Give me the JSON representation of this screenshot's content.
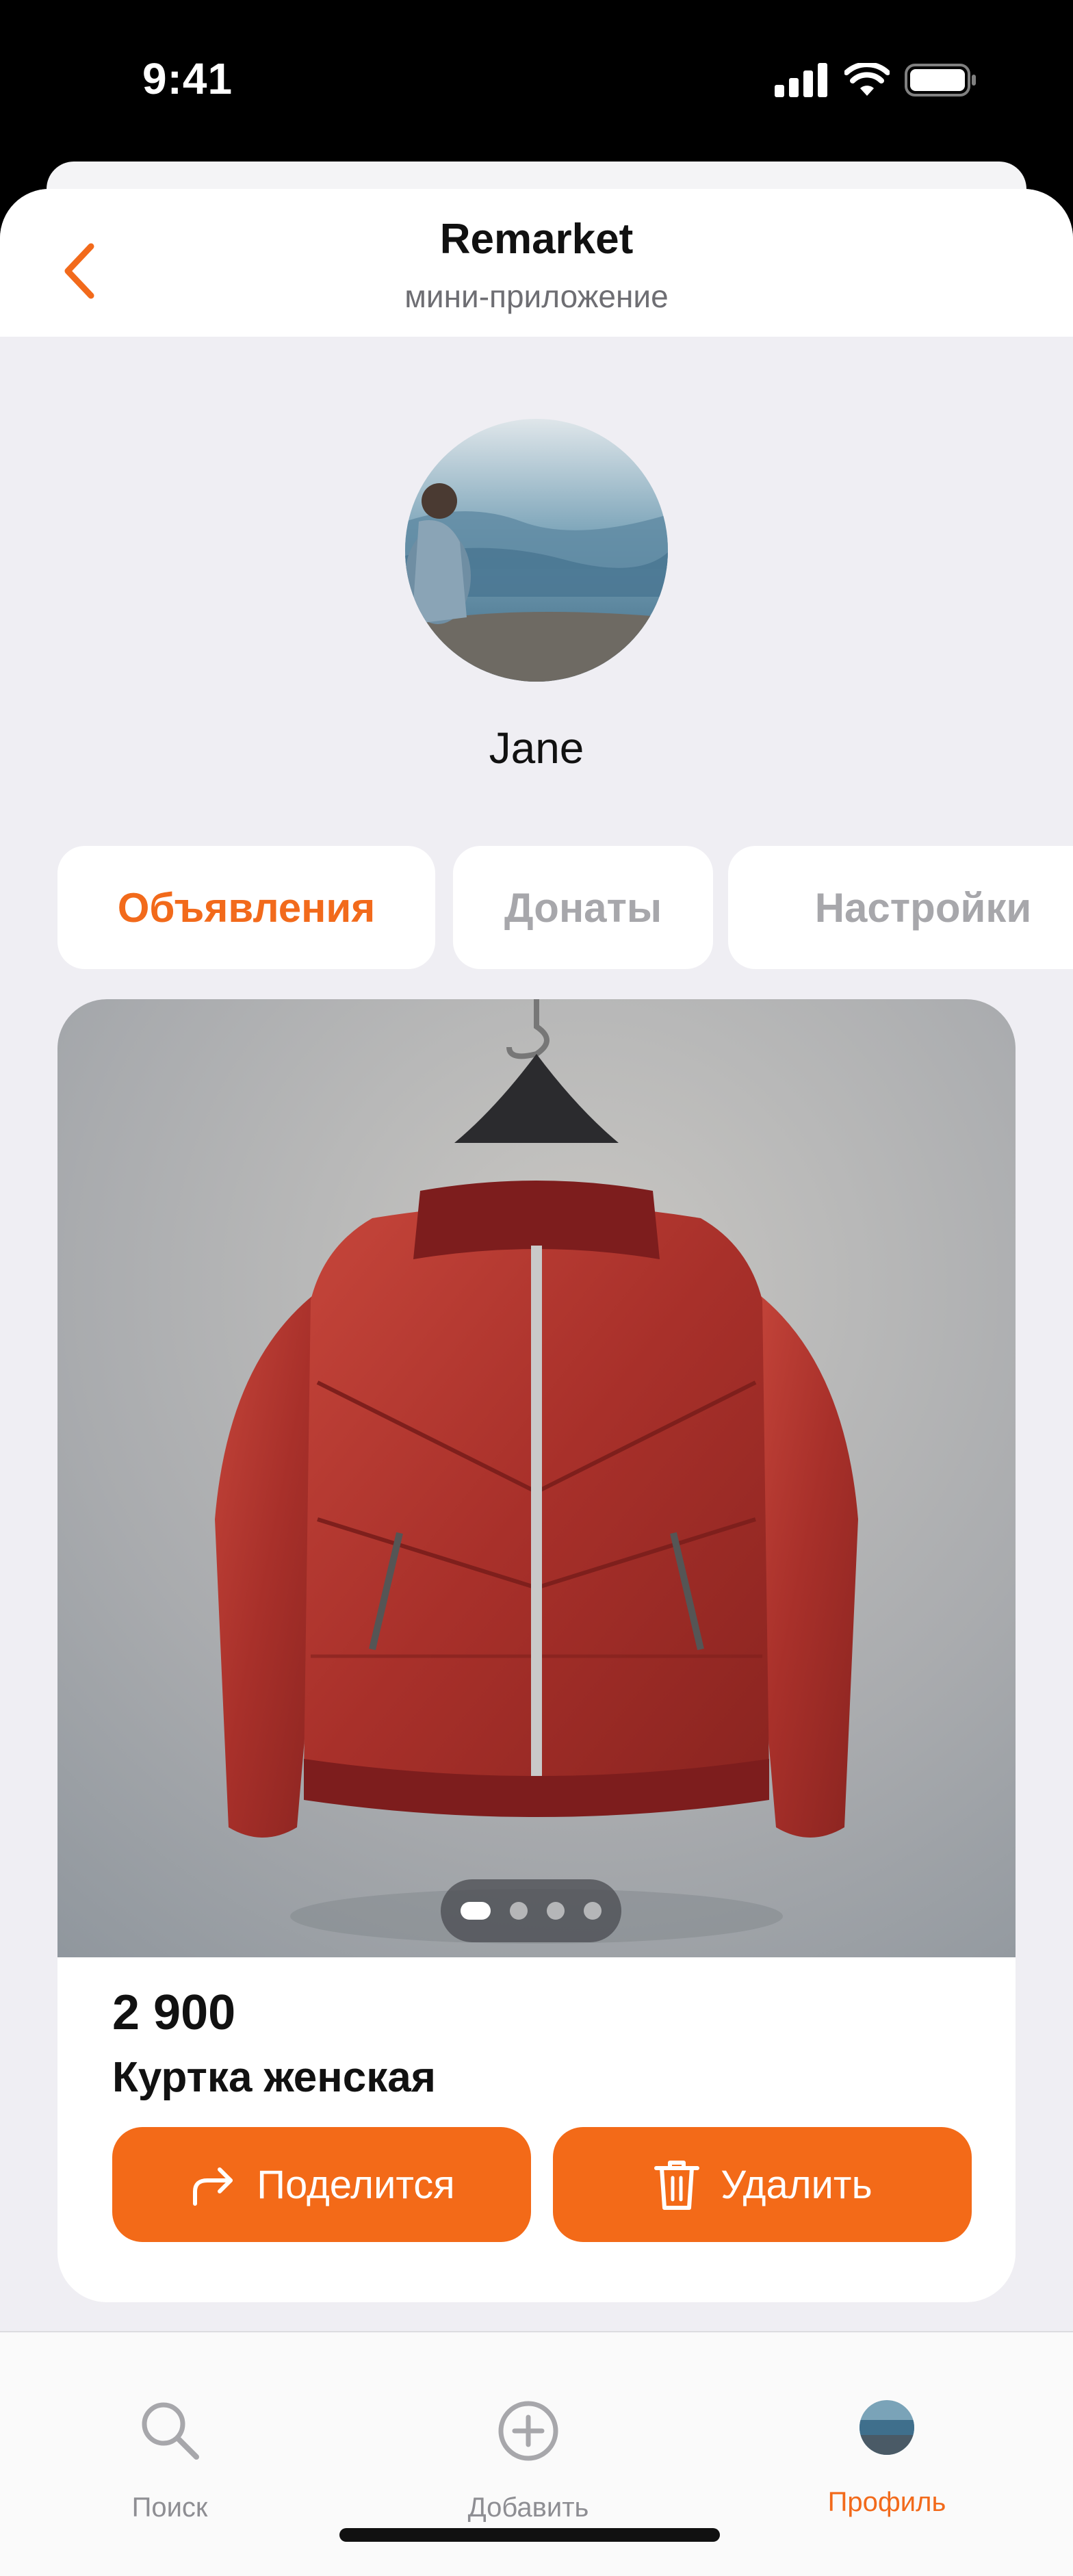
{
  "status_bar": {
    "time": "9:41"
  },
  "header": {
    "title": "Remarket",
    "subtitle": "мини-приложение",
    "back_icon": "chevron-left-icon"
  },
  "profile": {
    "name": "Jane"
  },
  "tabs": [
    {
      "label": "Объявления",
      "active": true
    },
    {
      "label": "Донаты",
      "active": false
    },
    {
      "label": "Настройки",
      "active": false
    }
  ],
  "listing": {
    "image_slides": 4,
    "active_slide": 1,
    "price": "2 900",
    "title": "Куртка женская",
    "share_label": "Поделится",
    "delete_label": "Удалить"
  },
  "tabbar": {
    "items": [
      {
        "label": "Поиск",
        "icon": "search-icon",
        "active": false
      },
      {
        "label": "Добавить",
        "icon": "add-circle-icon",
        "active": false
      },
      {
        "label": "Профиль",
        "icon": "avatar-icon",
        "active": true
      }
    ]
  },
  "colors": {
    "accent": "#f36a18",
    "background": "#efeef3",
    "inactive": "#a7a7ab"
  }
}
